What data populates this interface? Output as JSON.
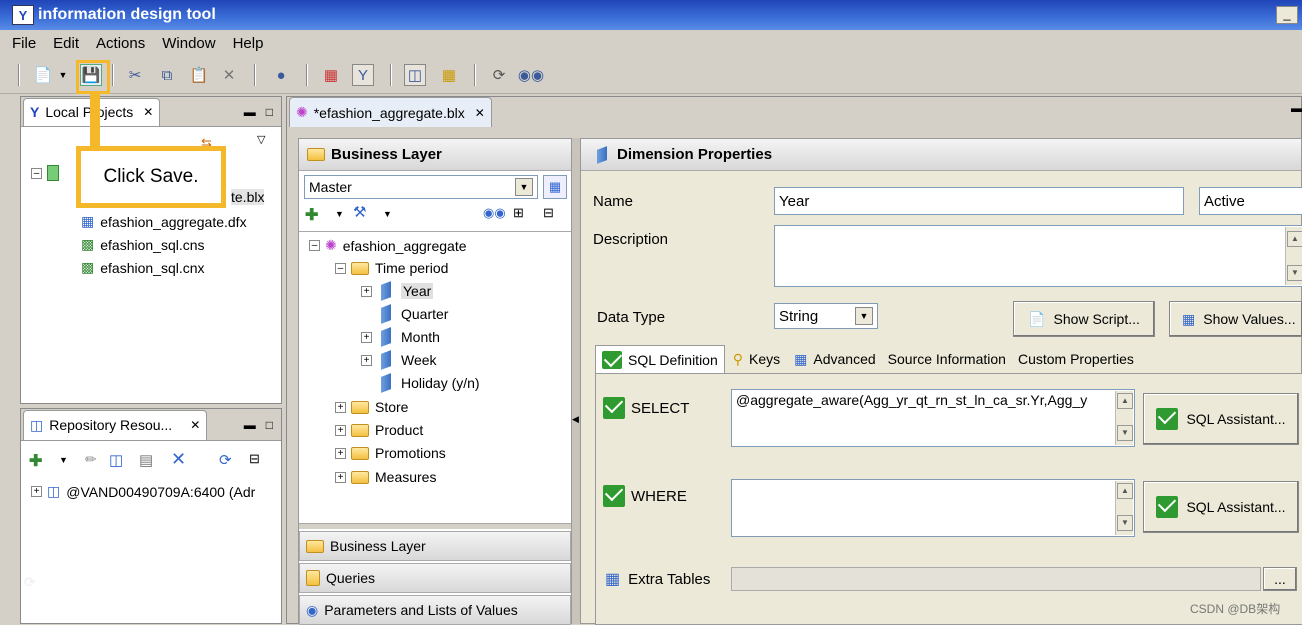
{
  "app": {
    "title": "information design tool",
    "min_symbol": "_"
  },
  "menu": [
    "File",
    "Edit",
    "Actions",
    "Window",
    "Help"
  ],
  "callout": {
    "text": "Click Save."
  },
  "local_projects": {
    "tab_label": "Local Projects",
    "items": [
      {
        "label": "efashion_aggregate.blx",
        "visible_part": "te.blx"
      },
      {
        "label": "efashion_aggregate.dfx"
      },
      {
        "label": "efashion_sql.cns"
      },
      {
        "label": "efashion_sql.cnx"
      }
    ]
  },
  "repository": {
    "tab_label": "Repository Resou...",
    "session": "@VAND00490709A:6400 (Adr"
  },
  "editor_tab": {
    "label": "*efashion_aggregate.blx"
  },
  "business_layer": {
    "header": "Business Layer",
    "view_select": "Master",
    "root": "efashion_aggregate",
    "tree": [
      "Time period",
      "Year",
      "Quarter",
      "Month",
      "Week",
      "Holiday (y/n)",
      "Store",
      "Product",
      "Promotions",
      "Measures"
    ],
    "bottom_tabs": [
      "Business Layer",
      "Queries",
      "Parameters and Lists of Values"
    ]
  },
  "dimension": {
    "header": "Dimension Properties",
    "name_label": "Name",
    "name_value": "Year",
    "state": "Active",
    "description_label": "Description",
    "data_type_label": "Data Type",
    "data_type": "String",
    "show_script": "Show Script...",
    "show_values": "Show Values...",
    "tabs": [
      "SQL Definition",
      "Keys",
      "Advanced",
      "Source Information",
      "Custom Properties"
    ],
    "select_label": "SELECT",
    "select_value": "@aggregate_aware(Agg_yr_qt_rn_st_ln_ca_sr.Yr,Agg_y",
    "where_label": "WHERE",
    "sql_assistant": "SQL Assistant...",
    "extra_tables_label": "Extra Tables",
    "ellipsis": "..."
  },
  "watermark": "CSDN @DB架构"
}
